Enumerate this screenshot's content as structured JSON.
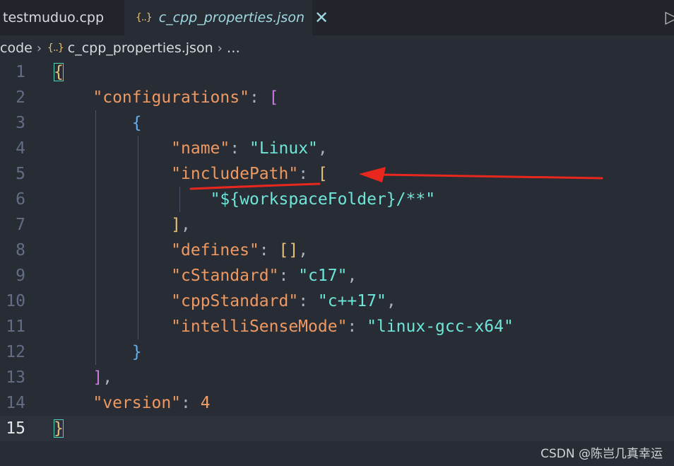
{
  "tabs": [
    {
      "label": "testmuduo.cpp",
      "active": false
    },
    {
      "label": "c_cpp_properties.json",
      "active": true,
      "icon": "{..}",
      "close": "✕"
    }
  ],
  "breadcrumb": {
    "folder": "code",
    "icon": "{..}",
    "file": "c_cpp_properties.json",
    "tail": "…",
    "sep": "›"
  },
  "editor": {
    "current_line": 15,
    "line_numbers": [
      "1",
      "2",
      "3",
      "4",
      "5",
      "6",
      "7",
      "8",
      "9",
      "10",
      "11",
      "12",
      "13",
      "14",
      "15"
    ],
    "code": {
      "configurations_key": "\"configurations\"",
      "name_key": "\"name\"",
      "name_value": "\"Linux\"",
      "includePath_key": "\"includePath\"",
      "includePath_value": "\"${workspaceFolder}/**\"",
      "defines_key": "\"defines\"",
      "cStandard_key": "\"cStandard\"",
      "cStandard_value": "\"c17\"",
      "cppStandard_key": "\"cppStandard\"",
      "cppStandard_value": "\"c++17\"",
      "intelliSenseMode_key": "\"intelliSenseMode\"",
      "intelliSenseMode_value": "\"linux-gcc-x64\"",
      "version_key": "\"version\"",
      "version_value": "4"
    }
  },
  "watermark": "CSDN @陈岂几真幸运",
  "colors": {
    "background": "#282c34",
    "key": "#ef9962",
    "string": "#6ee6d9",
    "annotation": "#e8281e"
  }
}
